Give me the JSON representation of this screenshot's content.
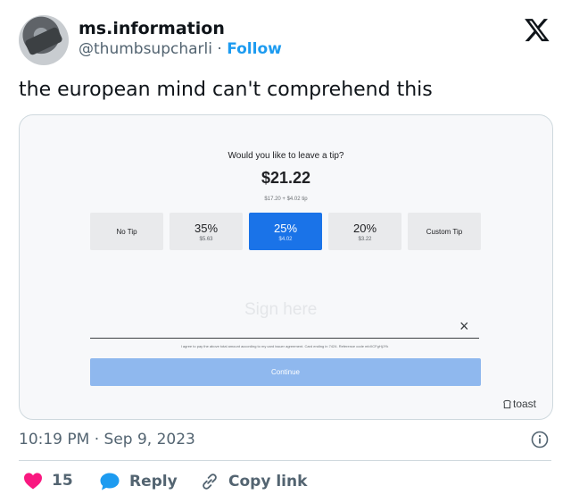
{
  "author": {
    "display_name": "ms.information",
    "handle": "@thumbsupcharli",
    "separator": "·",
    "follow_label": "Follow"
  },
  "tweet": {
    "text": "the european mind can't comprehend this",
    "timestamp": "10:19 PM · Sep 9, 2023"
  },
  "tip_screen": {
    "question": "Would you like to leave a tip?",
    "total": "$21.22",
    "breakdown": "$17.20 + $4.02 tip",
    "options": [
      {
        "label": "No Tip",
        "amount": ""
      },
      {
        "label": "35%",
        "amount": "$5.63"
      },
      {
        "label": "25%",
        "amount": "$4.02"
      },
      {
        "label": "20%",
        "amount": "$3.22"
      },
      {
        "label": "Custom Tip",
        "amount": ""
      }
    ],
    "selected_index": 2,
    "signature_placeholder": "Sign here",
    "clear_symbol": "×",
    "agreement": "I agree to pay the above total amount according to my card issuer agreement. Card ending in 7424. Reference code mbXCFgHjJYk",
    "continue_label": "Continue",
    "brand": "toast"
  },
  "actions": {
    "likes_count": "15",
    "reply_label": "Reply",
    "copy_link_label": "Copy link"
  },
  "colors": {
    "accent": "#1d9bf0",
    "tip_selected": "#1a73e8",
    "continue_button": "#8fb8ee",
    "heart": "#f91880"
  },
  "icons": [
    "x-logo-icon",
    "info-icon",
    "heart-icon",
    "reply-bubble-icon",
    "link-icon",
    "toast-logo-icon"
  ]
}
